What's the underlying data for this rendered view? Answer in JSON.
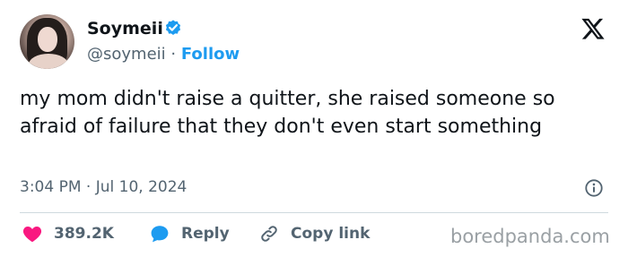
{
  "user": {
    "display_name": "Soymeii",
    "handle": "@soymeii",
    "separator": "·",
    "follow_label": "Follow"
  },
  "tweet": {
    "text": "my mom didn't raise a quitter, she raised someone so afraid of failure that they don't even start something",
    "timestamp": "3:04 PM · Jul 10, 2024"
  },
  "actions": {
    "likes": "389.2K",
    "reply_label": "Reply",
    "copy_label": "Copy link"
  },
  "watermark": "boredpanda.com",
  "icons": {
    "verified": "verified-badge-icon",
    "platform": "x-logo-icon",
    "info": "info-icon",
    "like": "heart-icon",
    "reply": "reply-bubble-icon",
    "copy": "link-icon"
  },
  "colors": {
    "accent": "#1d9bf0",
    "like": "#f91880",
    "text": "#0f1419",
    "muted": "#536471",
    "divider": "#cfd9de"
  }
}
